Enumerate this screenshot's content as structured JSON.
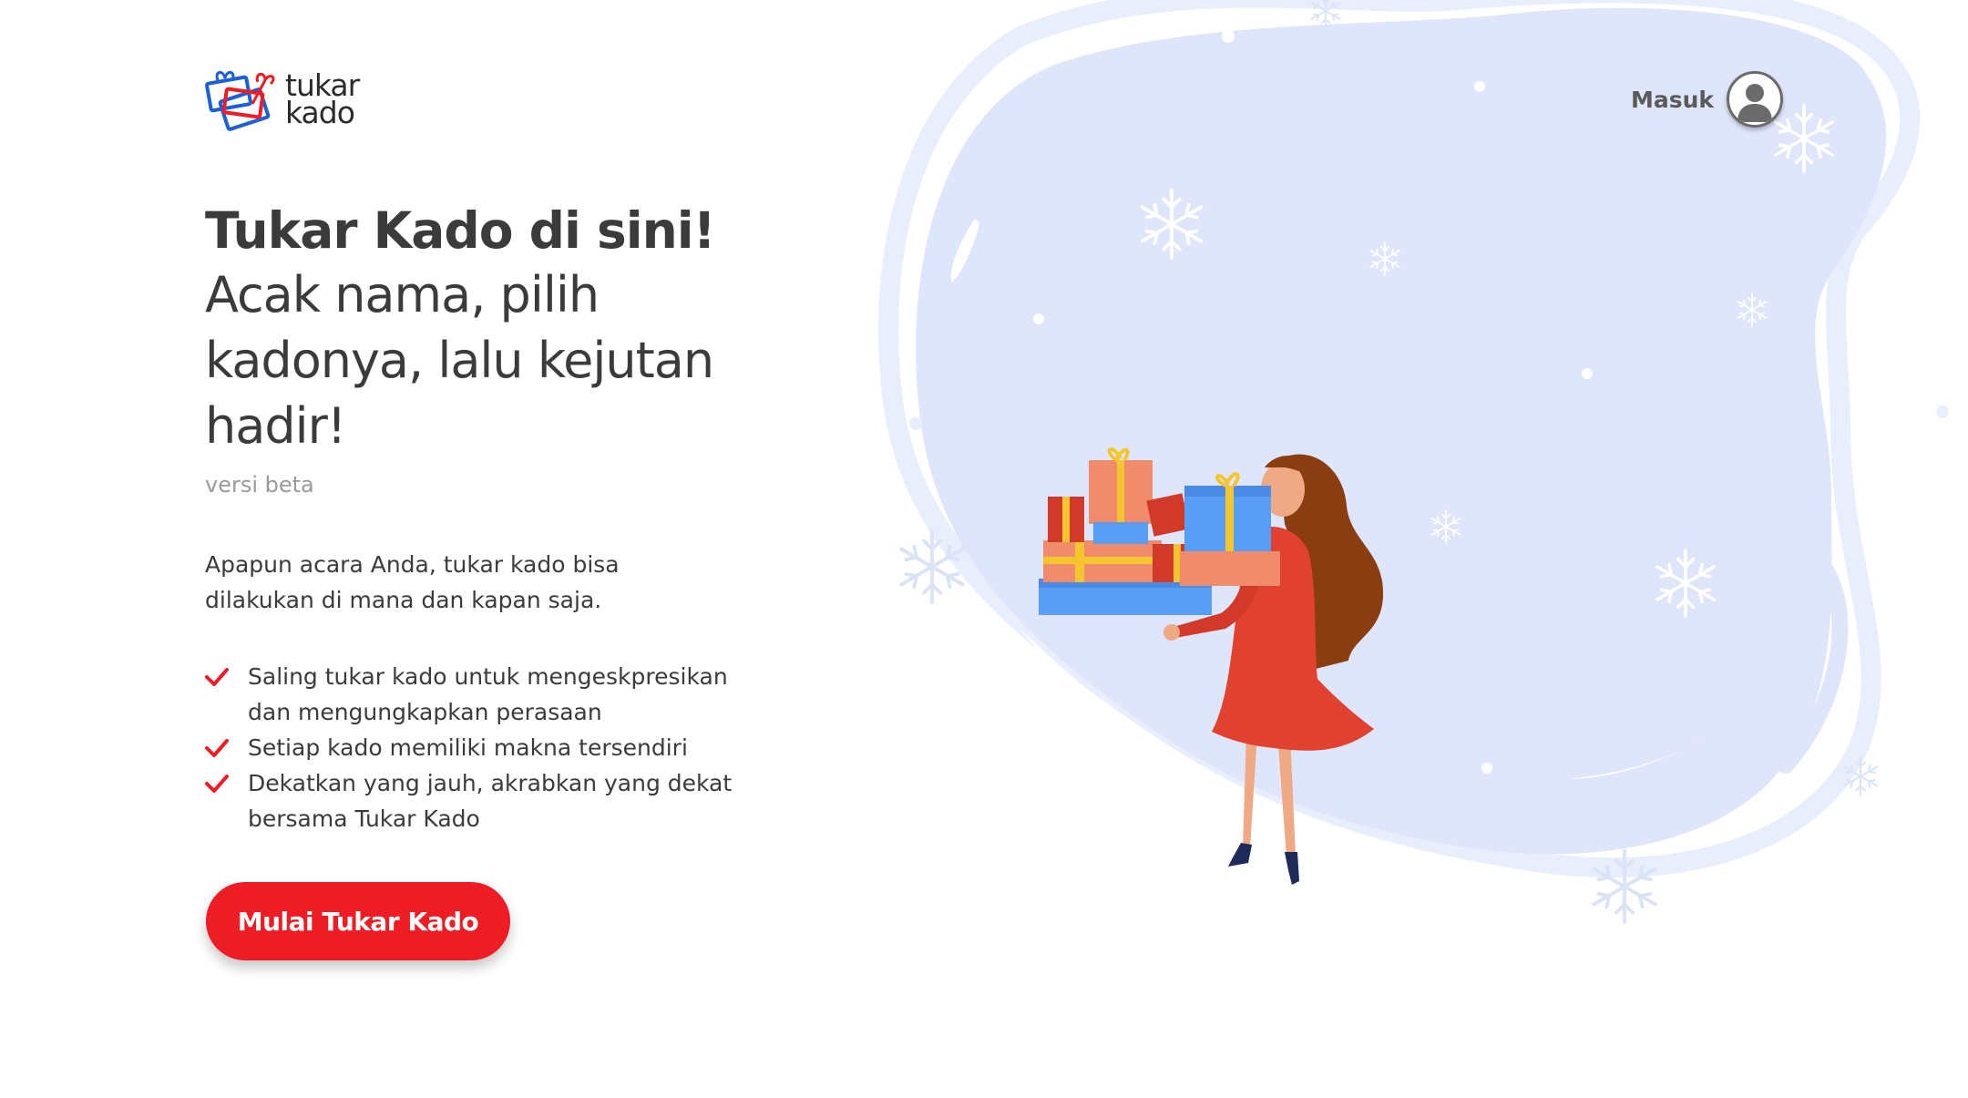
{
  "brand": {
    "logo_line1": "tukar",
    "logo_line2": "kado"
  },
  "header": {
    "login_label": "Masuk"
  },
  "hero": {
    "title": "Tukar Kado di sini!",
    "subtitle": "Acak nama, pilih kadonya, lalu kejutan hadir!",
    "version": "versi beta"
  },
  "intro": "Apapun acara Anda, tukar kado bisa dilakukan di mana dan kapan saja.",
  "features": [
    "Saling tukar kado untuk mengeskpresikan dan mengungkapkan perasaan",
    "Setiap kado memiliki makna tersendiri",
    "Dekatkan yang jauh, akrabkan yang dekat bersama Tukar Kado"
  ],
  "cta": {
    "label": "Mulai Tukar Kado"
  },
  "icons": {
    "check": "check-icon",
    "avatar": "user-avatar-icon",
    "snowflake": "snowflake-icon",
    "logo": "gift-box-logo"
  },
  "colors": {
    "accent": "#ee1c25",
    "blob": "#dfe6fb",
    "blob_outline": "#e8eefc",
    "text": "#3b3b3b",
    "muted": "#9a9a9a"
  }
}
